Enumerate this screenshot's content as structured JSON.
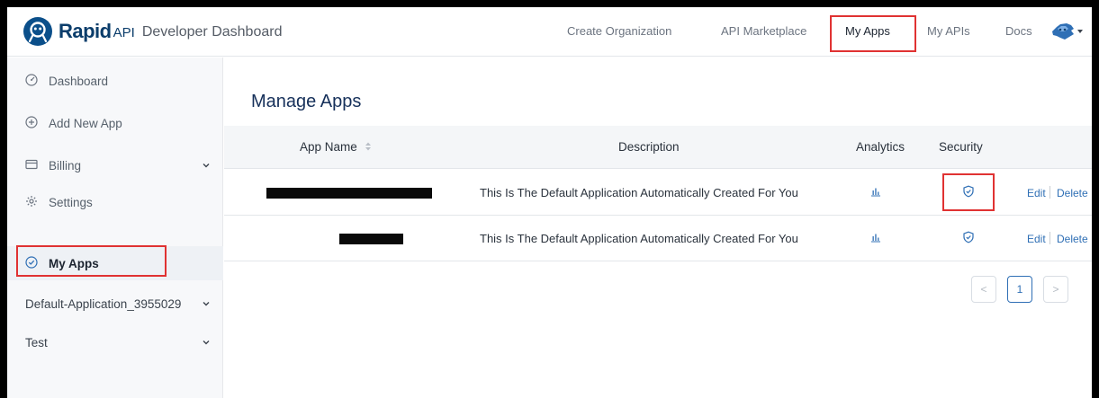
{
  "header": {
    "brand_main": "Rapid",
    "brand_api": "API",
    "brand_sub": "Developer Dashboard",
    "nav": [
      {
        "label": "Create Organization"
      },
      {
        "label": "API Marketplace"
      },
      {
        "label": "My Apps",
        "active": true
      },
      {
        "label": "My APIs"
      },
      {
        "label": "Docs"
      }
    ],
    "logo_icon": "rapidapi-logo-icon",
    "avatar_icon": "user-avatar-icon"
  },
  "sidebar": {
    "items": [
      {
        "label": "Dashboard",
        "icon": "dashboard-icon"
      },
      {
        "label": "Add New App",
        "icon": "plus-circle-icon"
      },
      {
        "label": "Billing",
        "icon": "card-icon",
        "expandable": true
      },
      {
        "label": "Settings",
        "icon": "gear-icon"
      },
      {
        "label": "My Apps",
        "icon": "check-circle-icon",
        "active": true
      },
      {
        "label": "Default-Application_3955029",
        "expandable": true
      },
      {
        "label": "Test",
        "expandable": true
      }
    ]
  },
  "main": {
    "title": "Manage Apps",
    "columns": [
      "App Name",
      "Description",
      "Analytics",
      "Security"
    ],
    "rows": [
      {
        "description": "This Is The Default Application Automatically Created For You",
        "edit": "Edit",
        "delete": "Delete"
      },
      {
        "description": "This Is The Default Application Automatically Created For You",
        "edit": "Edit",
        "delete": "Delete"
      }
    ],
    "pagination": {
      "prev": "<",
      "current": "1",
      "next": ">"
    }
  },
  "colors": {
    "accent": "#2f6fb5",
    "highlight": "#e03232",
    "brand": "#0b3d6b"
  }
}
